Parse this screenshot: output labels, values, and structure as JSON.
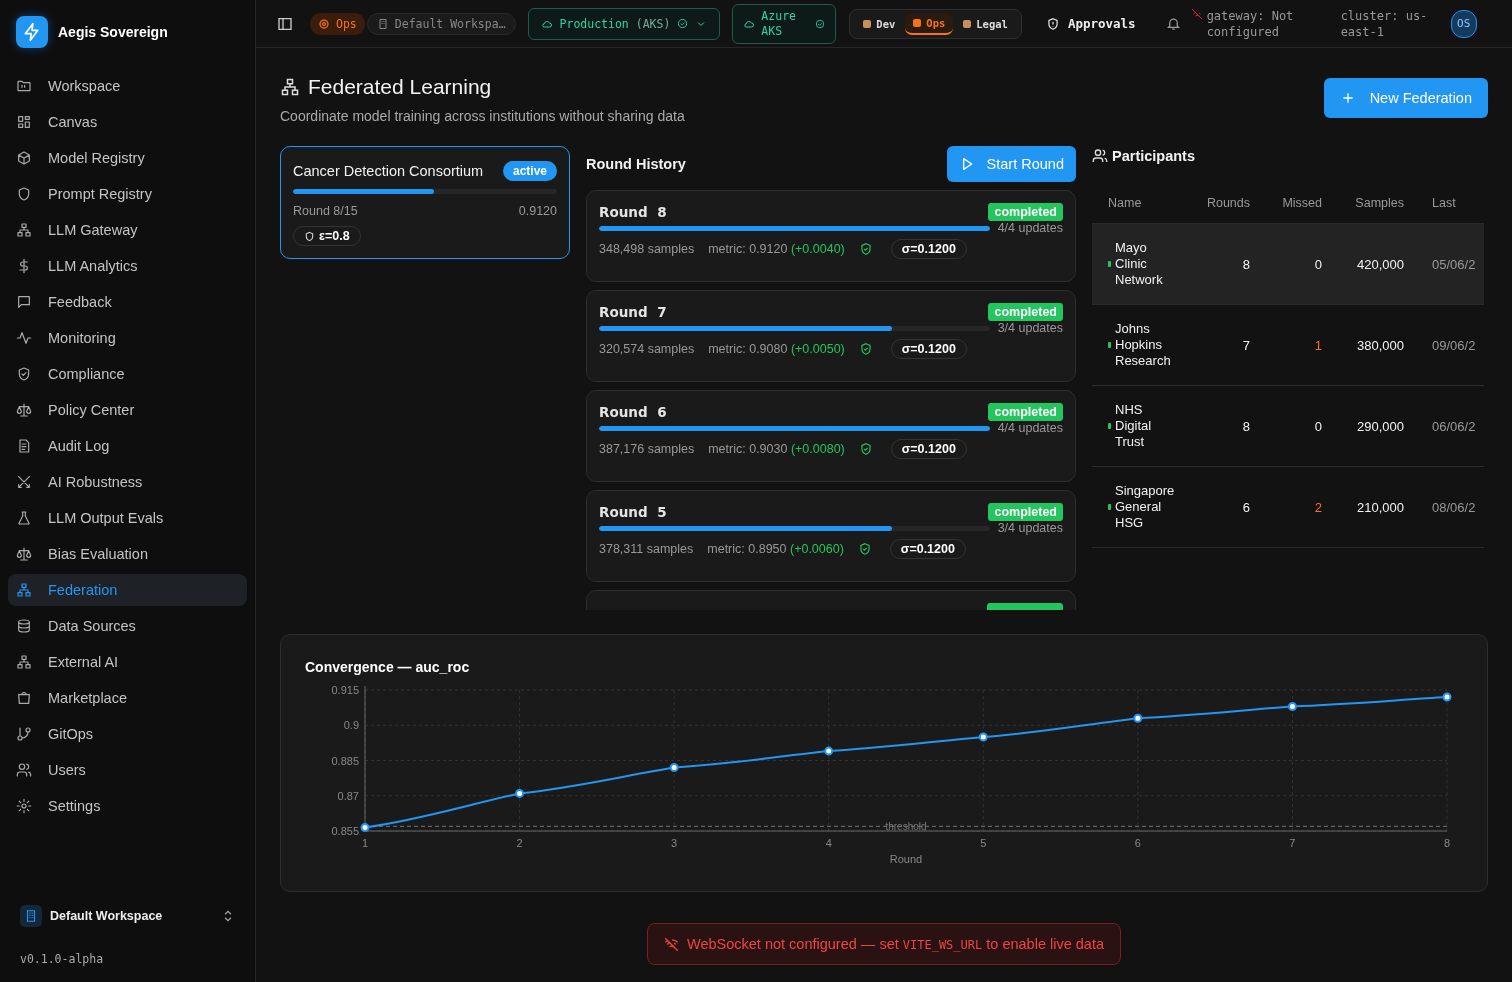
{
  "sidebar": {
    "brand": "Aegis Sovereign",
    "items": [
      {
        "label": "Workspace",
        "selected": false
      },
      {
        "label": "Canvas",
        "selected": false
      },
      {
        "label": "Model Registry",
        "selected": false
      },
      {
        "label": "Prompt Registry",
        "selected": false
      },
      {
        "label": "LLM Gateway",
        "selected": false
      },
      {
        "label": "LLM Analytics",
        "selected": false
      },
      {
        "label": "Feedback",
        "selected": false
      },
      {
        "label": "Monitoring",
        "selected": false
      },
      {
        "label": "Compliance",
        "selected": false
      },
      {
        "label": "Policy Center",
        "selected": false
      },
      {
        "label": "Audit Log",
        "selected": false
      },
      {
        "label": "AI Robustness",
        "selected": false
      },
      {
        "label": "LLM Output Evals",
        "selected": false
      },
      {
        "label": "Bias Evaluation",
        "selected": false
      },
      {
        "label": "Federation",
        "selected": true
      },
      {
        "label": "Data Sources",
        "selected": false
      },
      {
        "label": "External AI",
        "selected": false
      },
      {
        "label": "Marketplace",
        "selected": false
      },
      {
        "label": "GitOps",
        "selected": false
      },
      {
        "label": "Users",
        "selected": false
      },
      {
        "label": "Settings",
        "selected": false
      }
    ],
    "workspace": "Default Workspace",
    "version": "v0.1.0-alpha"
  },
  "topbar": {
    "mode": "Ops",
    "workspace": "Default Workspa…",
    "environment": "Production",
    "environment_suffix": "(AKS)",
    "cluster_chip": "Azure AKS",
    "personas": [
      {
        "label": "Dev",
        "selected": false
      },
      {
        "label": "Ops",
        "selected": true
      },
      {
        "label": "Legal",
        "selected": false
      }
    ],
    "approvals": "Approvals",
    "gateway": "gateway: Not configured",
    "cluster": "cluster: us-east-1",
    "avatar": "OS"
  },
  "header": {
    "title": "Federated Learning",
    "subtitle": "Coordinate model training across institutions without sharing data",
    "new_button": "New Federation"
  },
  "federations": [
    {
      "name": "Cancer Detection Consortium",
      "status": "active",
      "selected": true,
      "level": 0.533,
      "round": "Round 8/15",
      "metric": "0.9120",
      "epsilon": "ε=0.8"
    }
  ],
  "round_history": {
    "title": "Round History",
    "start_button": "Start Round",
    "rounds": [
      {
        "title": "Round 8",
        "status": "completed",
        "level": 1.0,
        "updates": "4/4 updates",
        "samples": "348,498 samples",
        "metric": "metric: 0.9120",
        "delta": "(+0.0040)",
        "sigma": "σ=0.1200"
      },
      {
        "title": "Round 7",
        "status": "completed",
        "level": 0.75,
        "updates": "3/4 updates",
        "samples": "320,574 samples",
        "metric": "metric: 0.9080",
        "delta": "(+0.0050)",
        "sigma": "σ=0.1200"
      },
      {
        "title": "Round 6",
        "status": "completed",
        "level": 1.0,
        "updates": "4/4 updates",
        "samples": "387,176 samples",
        "metric": "metric: 0.9030",
        "delta": "(+0.0080)",
        "sigma": "σ=0.1200"
      },
      {
        "title": "Round 5",
        "status": "completed",
        "level": 0.75,
        "updates": "3/4 updates",
        "samples": "378,311 samples",
        "metric": "metric: 0.8950",
        "delta": "(+0.0060)",
        "sigma": "σ=0.1200"
      }
    ]
  },
  "participants": {
    "title": "Participants",
    "columns": [
      "Name",
      "Rounds",
      "Missed",
      "Samples",
      "Last"
    ],
    "rows": [
      {
        "name": "Mayo Clinic Network",
        "rounds": "8",
        "missed": "0",
        "flagged": false,
        "samples": "420,000",
        "last": "05/06/2",
        "selected": true
      },
      {
        "name": "Johns Hopkins Research",
        "rounds": "7",
        "missed": "1",
        "flagged": true,
        "samples": "380,000",
        "last": "09/06/2",
        "selected": false
      },
      {
        "name": "NHS Digital Trust",
        "rounds": "8",
        "missed": "0",
        "flagged": false,
        "samples": "290,000",
        "last": "06/06/2",
        "selected": false
      },
      {
        "name": "Singapore General HSG",
        "rounds": "6",
        "missed": "2",
        "flagged": true,
        "samples": "210,000",
        "last": "08/06/2",
        "selected": false
      }
    ]
  },
  "convergence": {
    "chart_data": {
      "type": "line",
      "title": "Convergence — auc_roc",
      "xlabel": "Round",
      "x": [
        1,
        2,
        3,
        4,
        5,
        6,
        7,
        8
      ],
      "xlim": [
        1,
        8
      ],
      "ylim": [
        0.855,
        0.915
      ],
      "yticks": [
        0.855,
        0.87,
        0.885,
        0.9,
        0.915
      ],
      "xticks": [
        1,
        2,
        3,
        4,
        5,
        6,
        7,
        8
      ],
      "grid": true,
      "series": [
        {
          "color": "#2196f3",
          "marker": true,
          "values": [
            0.8565,
            0.871,
            0.882,
            0.889,
            0.895,
            0.903,
            0.908,
            0.912
          ]
        }
      ],
      "ref_lines": [
        {
          "axis": "y",
          "value": 0.857,
          "label": "threshold"
        }
      ]
    }
  },
  "toast": {
    "before": "WebSocket not configured — set ",
    "code": "VITE_WS_URL",
    "after": " to enable live data"
  }
}
